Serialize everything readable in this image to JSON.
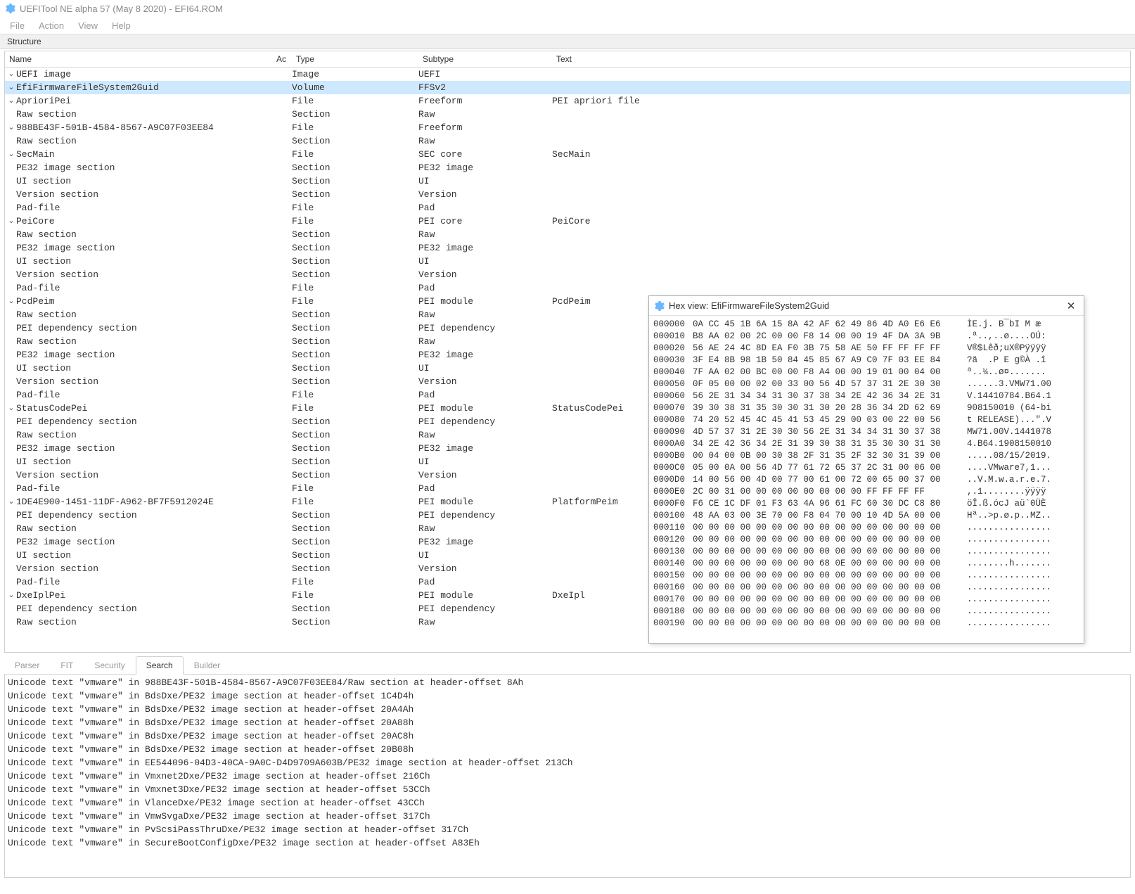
{
  "title": "UEFITool NE alpha 57 (May  8 2020) - EFI64.ROM",
  "menu": {
    "file": "File",
    "action": "Action",
    "view": "View",
    "help": "Help"
  },
  "structure_label": "Structure",
  "columns": {
    "name": "Name",
    "ac": "Ac",
    "type": "Type",
    "subtype": "Subtype",
    "text": "Text"
  },
  "tree": [
    {
      "indent": 0,
      "exp": "v",
      "name": "UEFI image",
      "type": "Image",
      "subtype": "UEFI",
      "text": "",
      "sel": false
    },
    {
      "indent": 1,
      "exp": "v",
      "name": "EfiFirmwareFileSystem2Guid",
      "type": "Volume",
      "subtype": "FFSv2",
      "text": "",
      "sel": true
    },
    {
      "indent": 2,
      "exp": "v",
      "name": "AprioriPei",
      "type": "File",
      "subtype": "Freeform",
      "text": "PEI apriori file"
    },
    {
      "indent": 3,
      "exp": "",
      "name": "Raw section",
      "type": "Section",
      "subtype": "Raw",
      "text": ""
    },
    {
      "indent": 2,
      "exp": "v",
      "name": "988BE43F-501B-4584-8567-A9C07F03EE84",
      "type": "File",
      "subtype": "Freeform",
      "text": ""
    },
    {
      "indent": 3,
      "exp": "",
      "name": "Raw section",
      "type": "Section",
      "subtype": "Raw",
      "text": ""
    },
    {
      "indent": 2,
      "exp": "v",
      "name": "SecMain",
      "type": "File",
      "subtype": "SEC core",
      "text": "SecMain"
    },
    {
      "indent": 3,
      "exp": "",
      "name": "PE32 image section",
      "type": "Section",
      "subtype": "PE32 image",
      "text": ""
    },
    {
      "indent": 3,
      "exp": "",
      "name": "UI section",
      "type": "Section",
      "subtype": "UI",
      "text": ""
    },
    {
      "indent": 3,
      "exp": "",
      "name": "Version section",
      "type": "Section",
      "subtype": "Version",
      "text": ""
    },
    {
      "indent": 2,
      "exp": "",
      "name": "Pad-file",
      "type": "File",
      "subtype": "Pad",
      "text": ""
    },
    {
      "indent": 2,
      "exp": "v",
      "name": "PeiCore",
      "type": "File",
      "subtype": "PEI core",
      "text": "PeiCore"
    },
    {
      "indent": 3,
      "exp": "",
      "name": "Raw section",
      "type": "Section",
      "subtype": "Raw",
      "text": ""
    },
    {
      "indent": 3,
      "exp": "",
      "name": "PE32 image section",
      "type": "Section",
      "subtype": "PE32 image",
      "text": ""
    },
    {
      "indent": 3,
      "exp": "",
      "name": "UI section",
      "type": "Section",
      "subtype": "UI",
      "text": ""
    },
    {
      "indent": 3,
      "exp": "",
      "name": "Version section",
      "type": "Section",
      "subtype": "Version",
      "text": ""
    },
    {
      "indent": 2,
      "exp": "",
      "name": "Pad-file",
      "type": "File",
      "subtype": "Pad",
      "text": ""
    },
    {
      "indent": 2,
      "exp": "v",
      "name": "PcdPeim",
      "type": "File",
      "subtype": "PEI module",
      "text": "PcdPeim"
    },
    {
      "indent": 3,
      "exp": "",
      "name": "Raw section",
      "type": "Section",
      "subtype": "Raw",
      "text": ""
    },
    {
      "indent": 3,
      "exp": "",
      "name": "PEI dependency section",
      "type": "Section",
      "subtype": "PEI dependency",
      "text": ""
    },
    {
      "indent": 3,
      "exp": "",
      "name": "Raw section",
      "type": "Section",
      "subtype": "Raw",
      "text": ""
    },
    {
      "indent": 3,
      "exp": "",
      "name": "PE32 image section",
      "type": "Section",
      "subtype": "PE32 image",
      "text": ""
    },
    {
      "indent": 3,
      "exp": "",
      "name": "UI section",
      "type": "Section",
      "subtype": "UI",
      "text": ""
    },
    {
      "indent": 3,
      "exp": "",
      "name": "Version section",
      "type": "Section",
      "subtype": "Version",
      "text": ""
    },
    {
      "indent": 2,
      "exp": "",
      "name": "Pad-file",
      "type": "File",
      "subtype": "Pad",
      "text": ""
    },
    {
      "indent": 2,
      "exp": "v",
      "name": "StatusCodePei",
      "type": "File",
      "subtype": "PEI module",
      "text": "StatusCodePei"
    },
    {
      "indent": 3,
      "exp": "",
      "name": "PEI dependency section",
      "type": "Section",
      "subtype": "PEI dependency",
      "text": ""
    },
    {
      "indent": 3,
      "exp": "",
      "name": "Raw section",
      "type": "Section",
      "subtype": "Raw",
      "text": ""
    },
    {
      "indent": 3,
      "exp": "",
      "name": "PE32 image section",
      "type": "Section",
      "subtype": "PE32 image",
      "text": ""
    },
    {
      "indent": 3,
      "exp": "",
      "name": "UI section",
      "type": "Section",
      "subtype": "UI",
      "text": ""
    },
    {
      "indent": 3,
      "exp": "",
      "name": "Version section",
      "type": "Section",
      "subtype": "Version",
      "text": ""
    },
    {
      "indent": 2,
      "exp": "",
      "name": "Pad-file",
      "type": "File",
      "subtype": "Pad",
      "text": ""
    },
    {
      "indent": 2,
      "exp": "v",
      "name": "1DE4E900-1451-11DF-A962-BF7F5912024E",
      "type": "File",
      "subtype": "PEI module",
      "text": "PlatformPeim"
    },
    {
      "indent": 3,
      "exp": "",
      "name": "PEI dependency section",
      "type": "Section",
      "subtype": "PEI dependency",
      "text": ""
    },
    {
      "indent": 3,
      "exp": "",
      "name": "Raw section",
      "type": "Section",
      "subtype": "Raw",
      "text": ""
    },
    {
      "indent": 3,
      "exp": "",
      "name": "PE32 image section",
      "type": "Section",
      "subtype": "PE32 image",
      "text": ""
    },
    {
      "indent": 3,
      "exp": "",
      "name": "UI section",
      "type": "Section",
      "subtype": "UI",
      "text": ""
    },
    {
      "indent": 3,
      "exp": "",
      "name": "Version section",
      "type": "Section",
      "subtype": "Version",
      "text": ""
    },
    {
      "indent": 2,
      "exp": "",
      "name": "Pad-file",
      "type": "File",
      "subtype": "Pad",
      "text": ""
    },
    {
      "indent": 2,
      "exp": "v",
      "name": "DxeIplPei",
      "type": "File",
      "subtype": "PEI module",
      "text": "DxeIpl"
    },
    {
      "indent": 3,
      "exp": "",
      "name": "PEI dependency section",
      "type": "Section",
      "subtype": "PEI dependency",
      "text": ""
    },
    {
      "indent": 3,
      "exp": "",
      "name": "Raw section",
      "type": "Section",
      "subtype": "Raw",
      "text": ""
    }
  ],
  "tabs": {
    "parser": "Parser",
    "fit": "FIT",
    "security": "Security",
    "search": "Search",
    "builder": "Builder"
  },
  "search_results": [
    "Unicode text \"vmware\" in 988BE43F-501B-4584-8567-A9C07F03EE84/Raw section at header-offset 8Ah",
    "Unicode text \"vmware\" in BdsDxe/PE32 image section at header-offset 1C4D4h",
    "Unicode text \"vmware\" in BdsDxe/PE32 image section at header-offset 20A4Ah",
    "Unicode text \"vmware\" in BdsDxe/PE32 image section at header-offset 20A88h",
    "Unicode text \"vmware\" in BdsDxe/PE32 image section at header-offset 20AC8h",
    "Unicode text \"vmware\" in BdsDxe/PE32 image section at header-offset 20B08h",
    "Unicode text \"vmware\" in EE544096-04D3-40CA-9A0C-D4D9709A603B/PE32 image section at header-offset 213Ch",
    "Unicode text \"vmware\" in Vmxnet2Dxe/PE32 image section at header-offset 216Ch",
    "Unicode text \"vmware\" in Vmxnet3Dxe/PE32 image section at header-offset 53CCh",
    "Unicode text \"vmware\" in VlanceDxe/PE32 image section at header-offset 43CCh",
    "Unicode text \"vmware\" in VmwSvgaDxe/PE32 image section at header-offset 317Ch",
    "Unicode text \"vmware\" in PvScsiPassThruDxe/PE32 image section at header-offset 317Ch",
    "Unicode text \"vmware\" in SecureBootConfigDxe/PE32 image section at header-offset A83Eh"
  ],
  "hex": {
    "title": "Hex view: EfiFirmwareFileSystem2Guid",
    "rows": [
      {
        "a": "000000",
        "b": "0A CC 45 1B 6A 15 8A 42 AF 62 49 86 4D A0 E6 E6",
        "s": "ÌE.j. B¯bI M æ"
      },
      {
        "a": "000010",
        "b": "B8 AA 02 00 2C 00 00 F8 14 00 00 19 4F DA 3A 9B",
        "s": ".ª..,..ø....OÚ:"
      },
      {
        "a": "000020",
        "b": "56 AE 24 4C 8D EA F0 3B 75 58 AE 50 FF FF FF FF",
        "s": "V®$Lêð;uX®Pÿÿÿÿ"
      },
      {
        "a": "000030",
        "b": "3F E4 8B 98 1B 50 84 45 85 67 A9 C0 7F 03 EE 84",
        "s": "?ä  .P E g©À .î"
      },
      {
        "a": "000040",
        "b": "7F AA 02 00 BC 00 00 F8 A4 00 00 19 01 00 04 00",
        "s": "ª..¼..ø¤......."
      },
      {
        "a": "000050",
        "b": "0F 05 00 00 02 00 33 00 56 4D 57 37 31 2E 30 30",
        "s": "......3.VMW71.00"
      },
      {
        "a": "000060",
        "b": "56 2E 31 34 34 31 30 37 38 34 2E 42 36 34 2E 31",
        "s": "V.14410784.B64.1"
      },
      {
        "a": "000070",
        "b": "39 30 38 31 35 30 30 31 30 20 28 36 34 2D 62 69",
        "s": "908150010 (64-bi"
      },
      {
        "a": "000080",
        "b": "74 20 52 45 4C 45 41 53 45 29 00 03 00 22 00 56",
        "s": "t RELEASE)...\".V"
      },
      {
        "a": "000090",
        "b": "4D 57 37 31 2E 30 30 56 2E 31 34 34 31 30 37 38",
        "s": "MW71.00V.1441078"
      },
      {
        "a": "0000A0",
        "b": "34 2E 42 36 34 2E 31 39 30 38 31 35 30 30 31 30",
        "s": "4.B64.1908150010"
      },
      {
        "a": "0000B0",
        "b": "00 04 00 0B 00 30 38 2F 31 35 2F 32 30 31 39 00",
        "s": ".....08/15/2019."
      },
      {
        "a": "0000C0",
        "b": "05 00 0A 00 56 4D 77 61 72 65 37 2C 31 00 06 00",
        "s": "....VMware7,1..."
      },
      {
        "a": "0000D0",
        "b": "14 00 56 00 4D 00 77 00 61 00 72 00 65 00 37 00",
        "s": "..V.M.w.a.r.e.7."
      },
      {
        "a": "0000E0",
        "b": "2C 00 31 00 00 00 00 00 00 00 00 FF FF FF FF",
        "s": ",.1........ÿÿÿÿ"
      },
      {
        "a": "0000F0",
        "b": "F6 CE 1C DF 01 F3 63 4A 96 61 FC 60 30 DC C8 80",
        "s": "öÎ.ß.ócJ aü`0ÜÈ"
      },
      {
        "a": "000100",
        "b": "48 AA 03 00 3E 70 00 F8 04 70 00 10 4D 5A 00 00",
        "s": "Hª..>p.ø.p..MZ.."
      },
      {
        "a": "000110",
        "b": "00 00 00 00 00 00 00 00 00 00 00 00 00 00 00 00",
        "s": "................"
      },
      {
        "a": "000120",
        "b": "00 00 00 00 00 00 00 00 00 00 00 00 00 00 00 00",
        "s": "................"
      },
      {
        "a": "000130",
        "b": "00 00 00 00 00 00 00 00 00 00 00 00 00 00 00 00",
        "s": "................"
      },
      {
        "a": "000140",
        "b": "00 00 00 00 00 00 00 00 68 0E 00 00 00 00 00 00",
        "s": "........h......."
      },
      {
        "a": "000150",
        "b": "00 00 00 00 00 00 00 00 00 00 00 00 00 00 00 00",
        "s": "................"
      },
      {
        "a": "000160",
        "b": "00 00 00 00 00 00 00 00 00 00 00 00 00 00 00 00",
        "s": "................"
      },
      {
        "a": "000170",
        "b": "00 00 00 00 00 00 00 00 00 00 00 00 00 00 00 00",
        "s": "................"
      },
      {
        "a": "000180",
        "b": "00 00 00 00 00 00 00 00 00 00 00 00 00 00 00 00",
        "s": "................"
      },
      {
        "a": "000190",
        "b": "00 00 00 00 00 00 00 00 00 00 00 00 00 00 00 00",
        "s": "................"
      }
    ]
  }
}
